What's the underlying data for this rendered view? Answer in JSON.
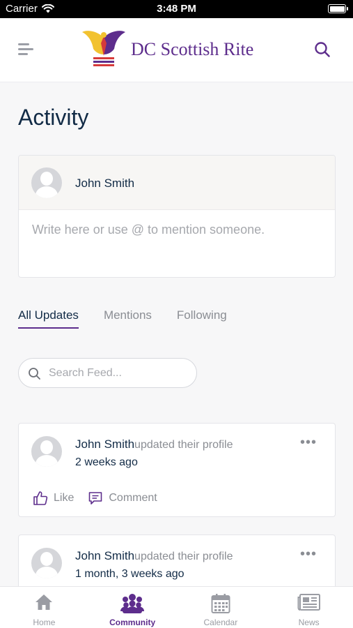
{
  "status_bar": {
    "carrier": "Carrier",
    "time": "3:48 PM"
  },
  "header": {
    "brand": "DC Scottish Rite"
  },
  "page": {
    "title": "Activity"
  },
  "composer": {
    "user_name": "John Smith",
    "placeholder": "Write here or use @ to mention someone."
  },
  "tabs": [
    {
      "label": "All Updates",
      "active": true
    },
    {
      "label": "Mentions",
      "active": false
    },
    {
      "label": "Following",
      "active": false
    }
  ],
  "search": {
    "placeholder": "Search Feed..."
  },
  "feed": [
    {
      "name": "John Smith",
      "action": "updated their profile",
      "time": "2 weeks ago",
      "like_label": "Like",
      "comment_label": "Comment",
      "more": "•••"
    },
    {
      "name": "John Smith",
      "action": "updated their profile",
      "time": "1 month, 3 weeks ago",
      "more": "•••"
    }
  ],
  "tab_bar": [
    {
      "label": "Home",
      "icon": "home-icon",
      "active": false
    },
    {
      "label": "Community",
      "icon": "community-icon",
      "active": true
    },
    {
      "label": "Calendar",
      "icon": "calendar-icon",
      "active": false
    },
    {
      "label": "News",
      "icon": "news-icon",
      "active": false
    }
  ],
  "colors": {
    "accent": "#5d2d8c",
    "text": "#122b46",
    "muted": "#8a8d93"
  }
}
